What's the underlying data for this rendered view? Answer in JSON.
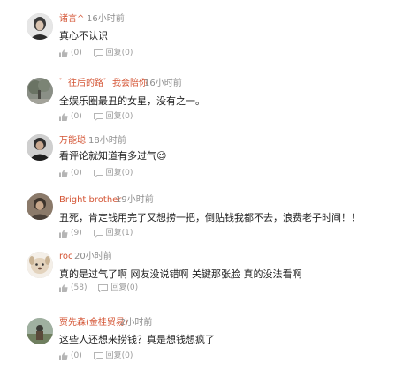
{
  "comments": [
    {
      "username": "诸言^",
      "time": "16小时前",
      "text": "真心不认识",
      "likes": "(0)",
      "reply": "回复(0)",
      "avatar_icon": "avatar-portrait-dark"
    },
    {
      "username": "゛往后的路゛我会陪你",
      "time": "16小时前",
      "text": "全娱乐圈最丑的女星，没有之一。",
      "likes": "(0)",
      "reply": "回复(0)",
      "avatar_icon": "avatar-tree-scene"
    },
    {
      "username": "万能聪",
      "time": "18小时前",
      "text": "看评论就知道有多过气😉",
      "likes": "(0)",
      "reply": "回复(0)",
      "avatar_icon": "avatar-person-dark"
    },
    {
      "username": "Bright brother",
      "time": "19小时前",
      "text": "丑死，肯定钱用完了又想捞一把，倒贴钱我都不去，浪费老子时间！！",
      "likes": "(9)",
      "reply": "回复(1)",
      "avatar_icon": "avatar-person-sepia"
    },
    {
      "username": "roc",
      "time": "20小时前",
      "text": "真的是过气了啊 网友没说错啊 关键那张脸 真的没法看啊",
      "likes": "(58)",
      "reply": "回复(0)",
      "avatar_icon": "avatar-cartoon-dog"
    },
    {
      "username": "贾先森(金桂贸易)",
      "time": "2小时前",
      "text": "这些人还想来捞钱？真是想钱想疯了",
      "likes": "(0)",
      "reply": "回复(0)",
      "avatar_icon": "avatar-outdoor-photo"
    }
  ],
  "colors": {
    "username": "#d45535",
    "meta": "#8c8c8c",
    "text": "#222222",
    "icon": "#b5b5b5"
  }
}
